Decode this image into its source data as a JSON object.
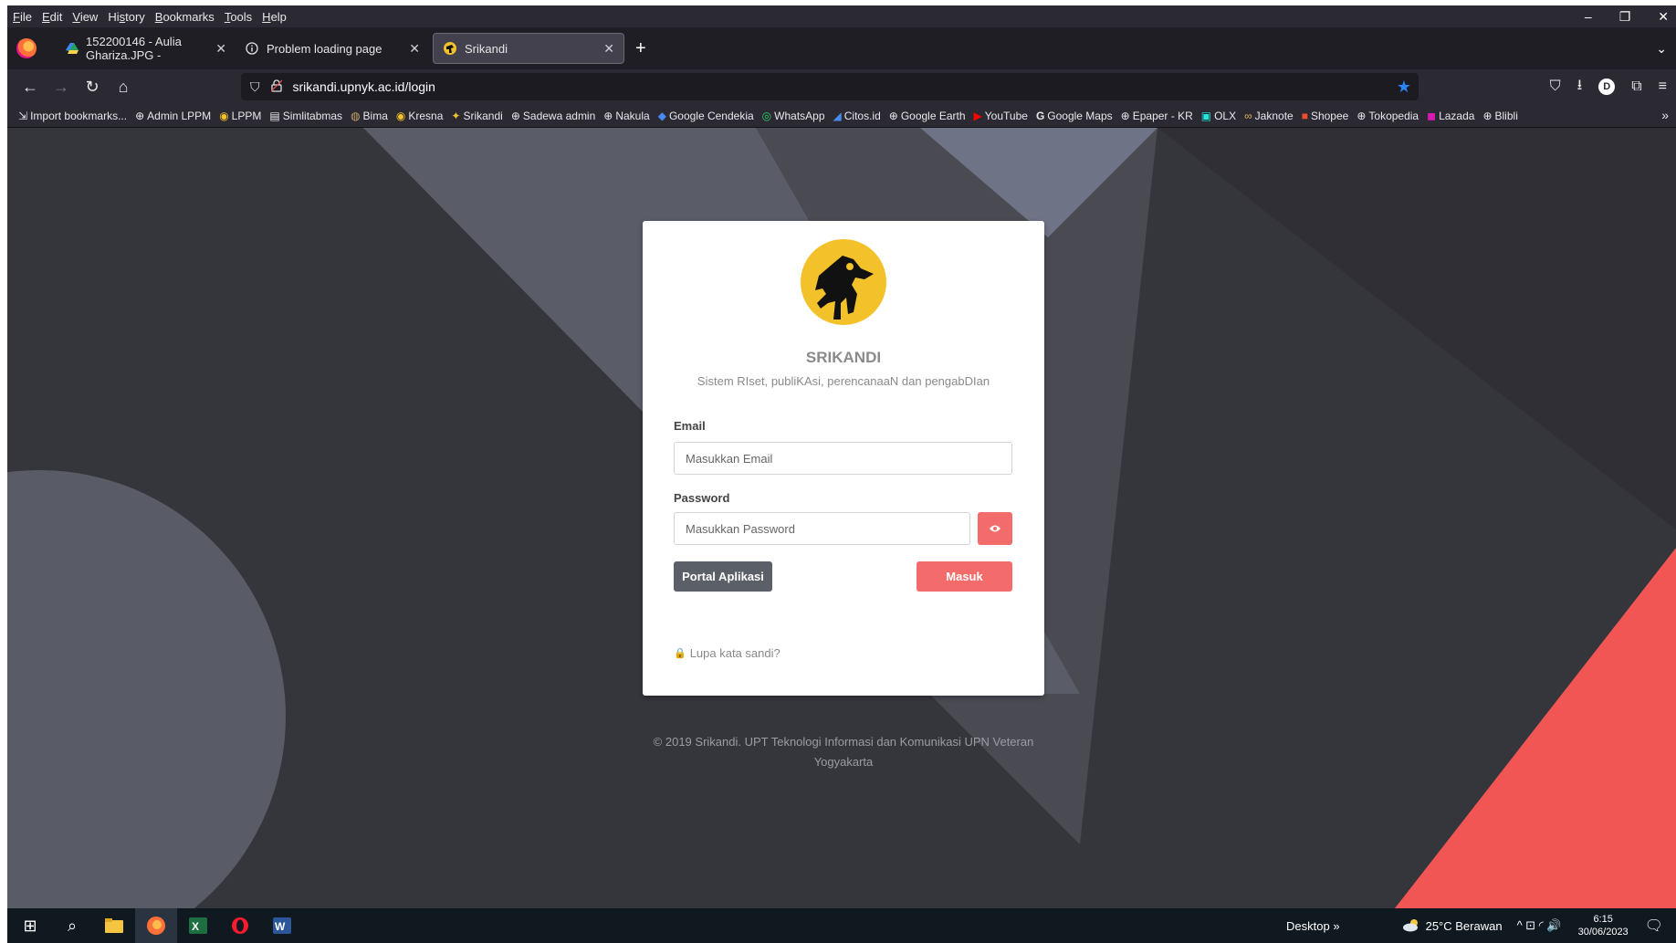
{
  "menubar": {
    "items": [
      "File",
      "Edit",
      "View",
      "History",
      "Bookmarks",
      "Tools",
      "Help"
    ],
    "mnemonics": [
      "F",
      "E",
      "V",
      "s",
      "B",
      "T",
      "H"
    ]
  },
  "window_controls": {
    "minimize": "–",
    "restore": "❐",
    "close": "✕"
  },
  "tabs": [
    {
      "title": "152200146 - Aulia Ghariza.JPG -",
      "icon": "google-drive-icon"
    },
    {
      "title": "Problem loading page",
      "icon": "info-icon"
    },
    {
      "title": "Srikandi",
      "icon": "srikandi-wayang-icon"
    }
  ],
  "tabstrip": {
    "new_tab": "+",
    "tab_close": "✕",
    "list_all": "⌄"
  },
  "navbar": {
    "back": "←",
    "forward": "→",
    "reload": "↻",
    "home": "⌂",
    "url_shield": "⛉",
    "url_lock": "🔒",
    "url": "srikandi.upnyk.ac.id/login",
    "bookmark_star": "★",
    "right_icons": [
      "pocket-icon",
      "download-icon",
      "account-icon",
      "extensions-icon",
      "menu-icon"
    ],
    "right_glyphs": [
      "⛉",
      "⭳",
      "D",
      "⧉",
      "≡"
    ]
  },
  "bookmarks": [
    {
      "label": "Import bookmarks...",
      "icon": "import-icon",
      "glyph": "⇲"
    },
    {
      "label": "Admin LPPM",
      "icon": "globe-icon",
      "glyph": "⊕"
    },
    {
      "label": "LPPM",
      "icon": "lppm-icon",
      "glyph": "◉"
    },
    {
      "label": "Simlitabmas",
      "icon": "page-icon",
      "glyph": "▤"
    },
    {
      "label": "Bima",
      "icon": "bima-icon",
      "glyph": "◍"
    },
    {
      "label": "Kresna",
      "icon": "kresna-icon",
      "glyph": "◉"
    },
    {
      "label": "Srikandi",
      "icon": "srikandi-icon",
      "glyph": "✦"
    },
    {
      "label": "Sadewa admin",
      "icon": "globe-icon",
      "glyph": "⊕"
    },
    {
      "label": "Nakula",
      "icon": "globe-icon",
      "glyph": "⊕"
    },
    {
      "label": "Google Cendekia",
      "icon": "scholar-icon",
      "glyph": "◆"
    },
    {
      "label": "WhatsApp",
      "icon": "whatsapp-icon",
      "glyph": "◎"
    },
    {
      "label": "Citos.id",
      "icon": "citos-icon",
      "glyph": "◢"
    },
    {
      "label": "Google Earth",
      "icon": "globe-icon",
      "glyph": "⊕"
    },
    {
      "label": "YouTube",
      "icon": "youtube-icon",
      "glyph": "▶"
    },
    {
      "label": "Google Maps",
      "icon": "google-icon",
      "glyph": "G"
    },
    {
      "label": "Epaper - KR",
      "icon": "globe-icon",
      "glyph": "⊕"
    },
    {
      "label": "OLX",
      "icon": "olx-icon",
      "glyph": "▣"
    },
    {
      "label": "Jaknote",
      "icon": "jaknote-icon",
      "glyph": "∞"
    },
    {
      "label": "Shopee",
      "icon": "shopee-icon",
      "glyph": "■"
    },
    {
      "label": "Tokopedia",
      "icon": "globe-icon",
      "glyph": "⊕"
    },
    {
      "label": "Lazada",
      "icon": "lazada-icon",
      "glyph": "◼"
    },
    {
      "label": "Blibli",
      "icon": "globe-icon",
      "glyph": "⊕"
    }
  ],
  "bookmarks_more": "»",
  "login": {
    "title": "SRIKANDI",
    "subtitle": "Sistem RIset, publiKAsi, perencanaaN dan pengabDIan",
    "email_label": "Email",
    "email_placeholder": "Masukkan Email",
    "password_label": "Password",
    "password_placeholder": "Masukkan Password",
    "portal_button": "Portal Aplikasi",
    "submit_button": "Masuk",
    "forgot_link": "Lupa kata sandi?",
    "lock_glyph": "🔒"
  },
  "footer": {
    "line1": "© 2019 Srikandi. UPT Teknologi Informasi dan Komunikasi UPN Veteran",
    "line2": "Yogyakarta"
  },
  "taskbar": {
    "start_glyph": "⊞",
    "search_glyph": "⌕",
    "apps": [
      "file-explorer-icon",
      "firefox-icon",
      "excel-icon",
      "opera-icon",
      "word-icon"
    ],
    "desktop_label": "Desktop",
    "desktop_chevron": "»",
    "weather": "25°C  Berawan",
    "tray_glyphs": "^  ⊡  ◜  🔊",
    "time": "6:15",
    "date": "30/06/2023",
    "notification_glyph": "🗨"
  },
  "colors": {
    "accent_red": "#f36c6b",
    "portal_gray": "#5a5f68",
    "logo_yellow": "#f3c12a",
    "page_bg": "#35353c"
  }
}
